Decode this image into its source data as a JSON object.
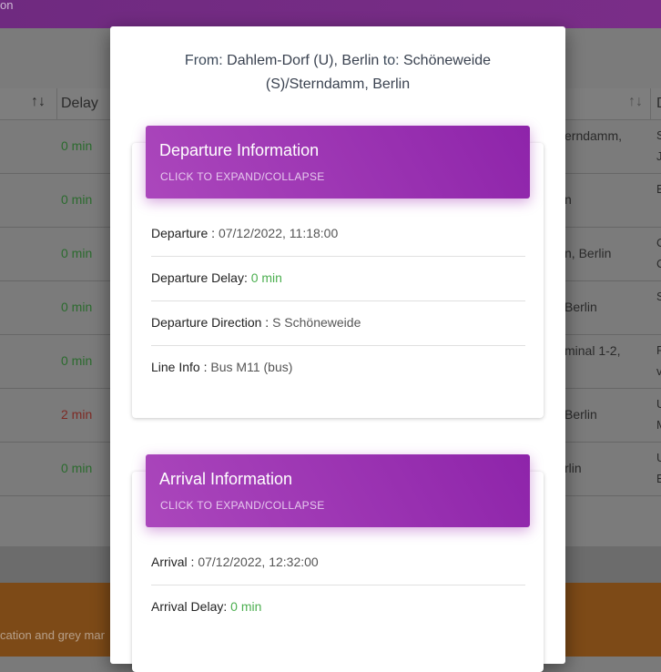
{
  "background": {
    "topbar_text": "on",
    "table": {
      "delay_header": "Delay",
      "right_header": "D",
      "rows": [
        {
          "delay": "0 min",
          "status": "ok",
          "right": "erndamm,",
          "right2": "S",
          "right3": "J"
        },
        {
          "delay": "0 min",
          "status": "ok",
          "right": "n",
          "right2": "E",
          "right3": ""
        },
        {
          "delay": "0 min",
          "status": "ok",
          "right": "n, Berlin",
          "right2": "C",
          "right3": "C"
        },
        {
          "delay": "0 min",
          "status": "ok",
          "right": "Berlin",
          "right2": "S",
          "right3": ""
        },
        {
          "delay": "0 min",
          "status": "ok",
          "right": "minal 1-2,",
          "right2": "F",
          "right3": "v"
        },
        {
          "delay": "2 min",
          "status": "late",
          "right": "Berlin",
          "right2": "U",
          "right3": "M"
        },
        {
          "delay": "0 min",
          "status": "ok",
          "right": "rlin",
          "right2": "U",
          "right3": "E"
        }
      ]
    },
    "footer_text": "cation and grey mar"
  },
  "modal": {
    "route": {
      "from_label": "From:",
      "from_place": "Dahlem-Dorf (U), Berlin",
      "to_label": "to:",
      "to_place": "Schöneweide (S)/Sterndamm, Berlin"
    },
    "departure": {
      "title": "Departure Information",
      "subtitle": "CLICK TO EXPAND/COLLAPSE",
      "departure_label": "Departure :",
      "departure_value": "07/12/2022, 11:18:00",
      "delay_label": "Departure Delay:",
      "delay_value": "0 min",
      "direction_label": "Departure Direction :",
      "direction_value": "S Schöneweide",
      "line_label": "Line Info :",
      "line_value": "Bus M11 (bus)"
    },
    "arrival": {
      "title": "Arrival Information",
      "subtitle": "CLICK TO EXPAND/COLLAPSE",
      "arrival_label": "Arrival :",
      "arrival_value": "07/12/2022, 12:32:00",
      "delay_label": "Arrival Delay:",
      "delay_value": "0 min"
    }
  },
  "colors": {
    "header_purple": "#9c27b0",
    "delay_ok": "#4caf50",
    "delay_late": "#f44336"
  }
}
